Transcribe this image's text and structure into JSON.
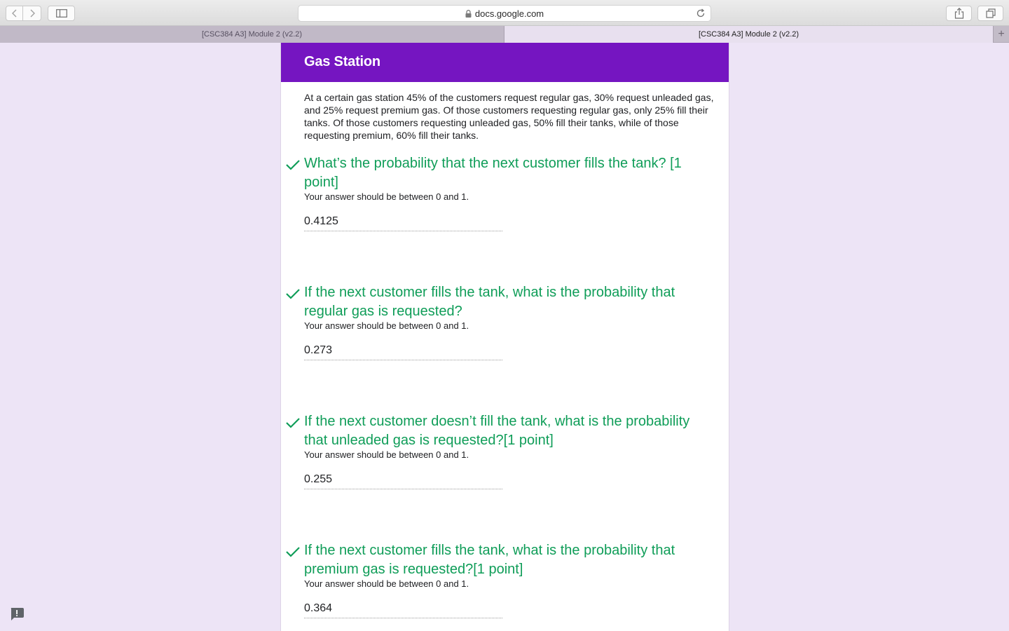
{
  "browser": {
    "url": "docs.google.com",
    "tabs": [
      {
        "label": "[CSC384 A3] Module 2 (v2.2)",
        "active": false
      },
      {
        "label": "[CSC384 A3] Module 2 (v2.2)",
        "active": true
      }
    ],
    "new_tab_label": "+",
    "icons": [
      "back-icon",
      "forward-icon",
      "sidebar-icon",
      "lock-icon",
      "reload-icon",
      "share-icon",
      "tabs-overview-icon"
    ]
  },
  "form": {
    "section_title": "Gas Station",
    "description": "At a certain gas station 45% of the customers request regular gas, 30% request unleaded gas, and 25% request premium gas. Of those customers requesting regular gas, only 25% fill their tanks. Of those customers requesting unleaded gas, 50% fill their tanks, while of those requesting premium, 60% fill their tanks.",
    "accent_color": "#7515c1",
    "correct_color": "#0f9d58",
    "questions": [
      {
        "title": "What’s the probability that the next customer fills the tank? [1 point]",
        "help": "Your answer should be between 0 and 1.",
        "answer": "0.4125",
        "status": "correct"
      },
      {
        "title": "If the next customer fills the tank, what is the probability that regular gas is requested?",
        "help": "Your answer should be between 0 and 1.",
        "answer": "0.273",
        "status": "correct"
      },
      {
        "title": "If the next customer doesn’t fill the tank, what is the probability that unleaded gas is requested?[1 point]",
        "help": "Your answer should be between 0 and 1.",
        "answer": "0.255",
        "status": "correct"
      },
      {
        "title": "If the next customer fills the tank, what is the probability that premium gas is requested?[1 point]",
        "help": "Your answer should be between 0 and 1.",
        "answer": "0.364",
        "status": "correct"
      }
    ]
  },
  "feedback_icon": "report-issue-icon"
}
